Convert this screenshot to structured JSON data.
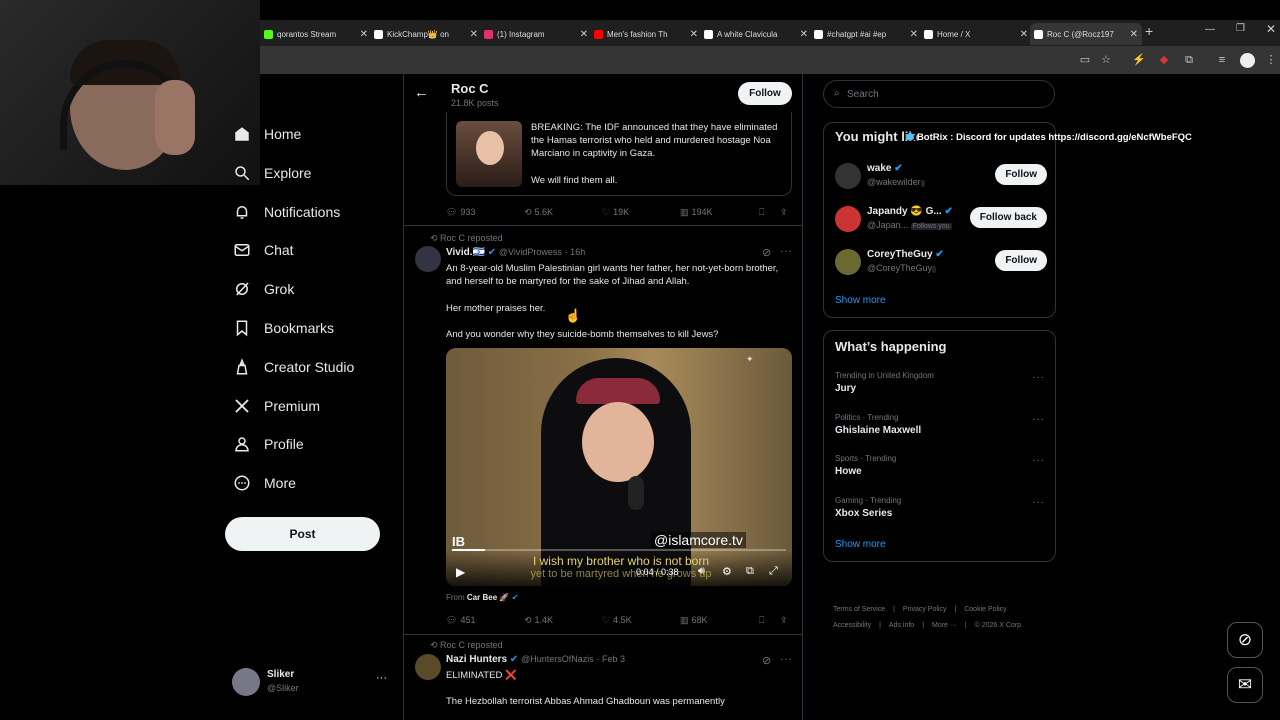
{
  "browser": {
    "tabs": [
      {
        "label": "qorantos Stream",
        "icon": "kick-icon",
        "color": "#53fc18"
      },
      {
        "label": "KickChamp👑 on",
        "icon": "x-logo-icon",
        "color": "#ffffff"
      },
      {
        "label": "(1) Instagram",
        "icon": "instagram-icon",
        "color": "#e1306c"
      },
      {
        "label": "Men's fashion Th",
        "icon": "youtube-icon",
        "color": "#ff0000"
      },
      {
        "label": "A white Clavicula",
        "icon": "tiktok-icon",
        "color": "#ffffff"
      },
      {
        "label": "#chatgpt #ai #ep",
        "icon": "tiktok-icon",
        "color": "#ffffff"
      },
      {
        "label": "Home / X",
        "icon": "x-logo-icon",
        "color": "#ffffff"
      },
      {
        "label": "Roc C (@Rocz197",
        "icon": "x-logo-icon",
        "color": "#ffffff"
      }
    ],
    "new_tab": "+"
  },
  "overlay": {
    "text": "BotRix : Discord for updates https://discord.gg/eNcfWbeFQC"
  },
  "nav": {
    "items": [
      {
        "label": "Home",
        "icon": "home-icon"
      },
      {
        "label": "Explore",
        "icon": "search-icon"
      },
      {
        "label": "Notifications",
        "icon": "bell-icon"
      },
      {
        "label": "Chat",
        "icon": "mail-icon"
      },
      {
        "label": "Grok",
        "icon": "grok-icon"
      },
      {
        "label": "Bookmarks",
        "icon": "bookmark-icon"
      },
      {
        "label": "Creator Studio",
        "icon": "creator-icon"
      },
      {
        "label": "Premium",
        "icon": "x-logo-icon"
      },
      {
        "label": "Profile",
        "icon": "person-icon"
      },
      {
        "label": "More",
        "icon": "more-circle-icon"
      }
    ],
    "post_label": "Post",
    "account": {
      "name": "Sliker",
      "handle": "@Sliker",
      "menu": "···"
    }
  },
  "header": {
    "name": "Roc C",
    "posts": "21.8K posts",
    "follow_label": "Follow"
  },
  "quoted": {
    "text1": "BREAKING: The IDF announced that they have eliminated the Hamas terrorist who held and murdered hostage Noa Marciano in captivity in Gaza.",
    "text2": "We will find them all."
  },
  "tweet1_actions": {
    "replies": "933",
    "reposts": "5.6K",
    "likes": "19K",
    "views": "194K"
  },
  "tweet2": {
    "repost_label": "Roc C reposted",
    "name": "Vivid.🇮🇱",
    "handle": "@VividProwess",
    "time": "· 16h",
    "p1": "An 8-year-old Muslim Palestinian girl wants her father, her not-yet-born brother, and herself to be martyred for the sake of Jihad and Allah.",
    "p2": "Her mother praises her.",
    "p3": "And you wonder why they suicide-bomb themselves to kill Jews?",
    "video": {
      "watermark": "@islamcore.tv",
      "corner": "IB",
      "subtitle1": "I wish my brother who is not born",
      "subtitle2": "yet to be martyred when he grows up",
      "time": "0:04 / 0:38",
      "progress": 0.1
    },
    "from_label": "From",
    "from_name": "Car Bee 🚀",
    "replies": "451",
    "reposts": "1.4K",
    "likes": "4.5K",
    "views": "68K"
  },
  "tweet3": {
    "repost_label": "Roc C reposted",
    "name": "Nazi Hunters",
    "handle": "@HuntersOfNazis",
    "time": "· Feb 3",
    "line1": "ELIMINATED ❌",
    "line2": "The Hezbollah terrorist Abbas Ahmad Ghadboun was permanently"
  },
  "right": {
    "search_placeholder": "Search",
    "wtf_title": "You might like",
    "suggestions": [
      {
        "name": "wake",
        "handle": "@wakewilder",
        "button": "Follow",
        "follows_you": ""
      },
      {
        "name": "Japandy 😎 G...",
        "handle": "@Japan...",
        "button": "Follow back",
        "follows_you": "Follows you"
      },
      {
        "name": "CoreyTheGuy",
        "handle": "@CoreyTheGuy",
        "button": "Follow",
        "follows_you": ""
      }
    ],
    "show_more": "Show more",
    "happening_title": "What’s happening",
    "trends": [
      {
        "category": "Trending in United Kingdom",
        "name": "Jury"
      },
      {
        "category": "Politics · Trending",
        "name": "Ghislaine Maxwell"
      },
      {
        "category": "Sports · Trending",
        "name": "Howe"
      },
      {
        "category": "Gaming · Trending",
        "name": "Xbox Series"
      }
    ],
    "show_more2": "Show more",
    "footer": [
      "Terms of Service",
      "Privacy Policy",
      "Cookie Policy",
      "Accessibility",
      "Ads info",
      "More ···",
      "© 2026 X Corp."
    ]
  }
}
